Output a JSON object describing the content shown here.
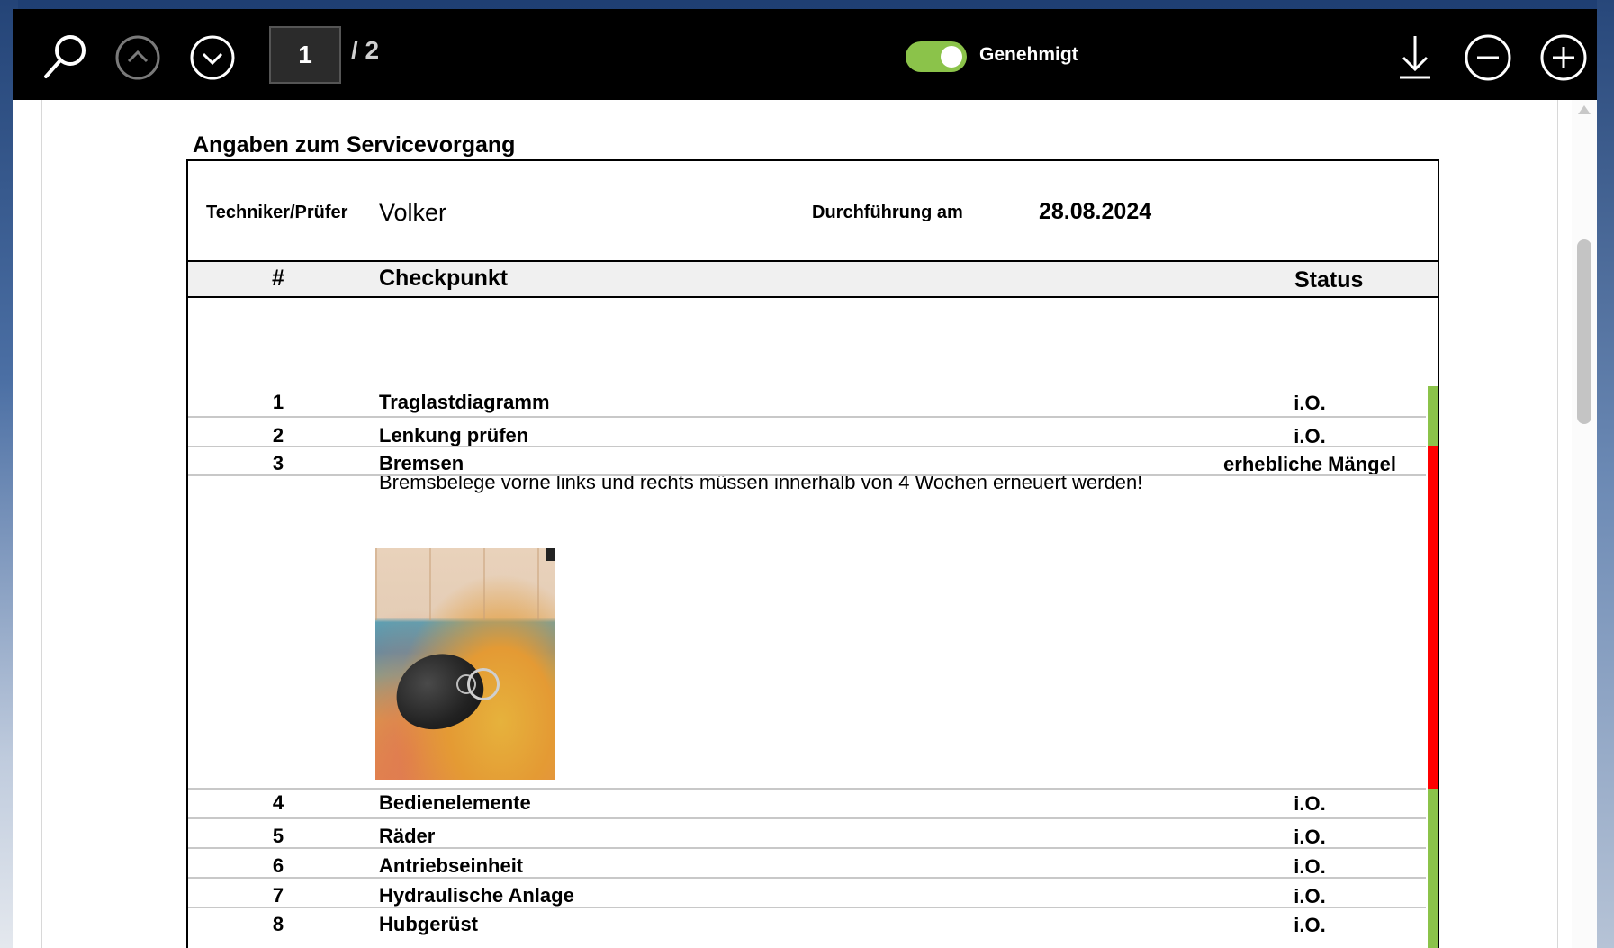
{
  "toolbar": {
    "page_current": "1",
    "page_total": "/ 2",
    "approved_label": "Genehmigt",
    "approved_on": true,
    "toggle_color": "#8bc34a"
  },
  "document": {
    "section_title": "Angaben zum Servicevorgang",
    "technician_label": "Techniker/Prüfer",
    "technician_value": "Volker",
    "date_label": "Durchführung am",
    "date_value": "28.08.2024",
    "header": {
      "num": "#",
      "checkpoint": "Checkpunkt",
      "status": "Status"
    },
    "rows": [
      {
        "num": "1",
        "label": "Traglastdiagramm",
        "status": "i.O.",
        "status_color": "#8bc34a"
      },
      {
        "num": "2",
        "label": "Lenkung prüfen",
        "status": "i.O.",
        "status_color": "#8bc34a"
      },
      {
        "num": "3",
        "label": "Bremsen",
        "status": "erhebliche Mängel",
        "status_color": "#ff0000",
        "note": "Bremsbelege vorne links und rechts müssen innerhalb von 4 Wochen erneuert werden!"
      },
      {
        "num": "4",
        "label": "Bedienelemente",
        "status": "i.O.",
        "status_color": "#8bc34a"
      },
      {
        "num": "5",
        "label": "Räder",
        "status": "i.O.",
        "status_color": "#8bc34a"
      },
      {
        "num": "6",
        "label": "Antriebseinheit",
        "status": "i.O.",
        "status_color": "#8bc34a"
      },
      {
        "num": "7",
        "label": "Hydraulische Anlage",
        "status": "i.O.",
        "status_color": "#8bc34a"
      },
      {
        "num": "8",
        "label": "Hubgerüst",
        "status": "i.O.",
        "status_color": "#8bc34a"
      }
    ]
  },
  "icons": [
    "search-icon",
    "chevron-up-icon",
    "chevron-down-icon",
    "download-icon",
    "zoom-out-icon",
    "zoom-in-icon"
  ]
}
